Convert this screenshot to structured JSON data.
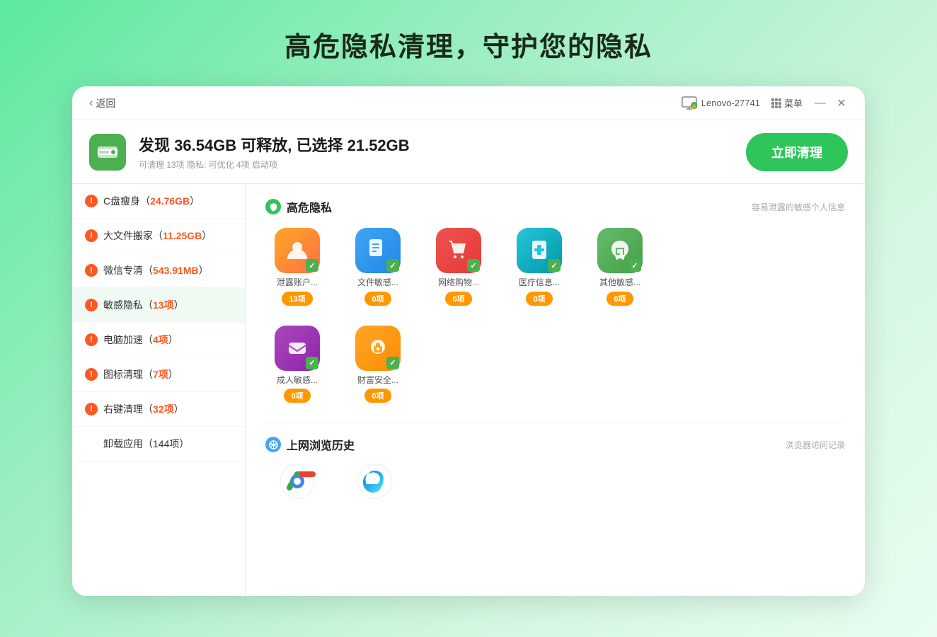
{
  "page": {
    "title": "高危隐私清理，守护您的隐私",
    "background": "linear-gradient(135deg, #5de8a0, #d4f7e0)"
  },
  "titlebar": {
    "back_label": "返回",
    "device_name": "Lenovo-27741",
    "menu_label": "菜单",
    "minimize_symbol": "—",
    "close_symbol": "✕"
  },
  "header": {
    "main_text": "发现 36.54GB 可释放, 已选择 21.52GB",
    "sub_text": "可清理 13项 隐私: 可优化 4项 启动项",
    "clean_button_label": "立即清理"
  },
  "sidebar": {
    "items": [
      {
        "id": "c-disk",
        "label": "C盘瘦身",
        "size": "24.76GB",
        "has_alert": true
      },
      {
        "id": "big-file",
        "label": "大文件搬家",
        "size": "11.25GB",
        "has_alert": true
      },
      {
        "id": "wechat",
        "label": "微信专清",
        "size": "543.91MB",
        "has_alert": true
      },
      {
        "id": "privacy",
        "label": "敏感隐私",
        "size": "13项",
        "has_alert": true,
        "active": true
      },
      {
        "id": "speed",
        "label": "电脑加速",
        "size": "4项",
        "has_alert": true
      },
      {
        "id": "icon-clean",
        "label": "图标清理",
        "size": "7项",
        "has_alert": true
      },
      {
        "id": "right-clean",
        "label": "右键清理",
        "size": "32项",
        "has_alert": true
      },
      {
        "id": "uninstall",
        "label": "卸载应用",
        "size": "144项",
        "has_alert": false
      }
    ]
  },
  "content": {
    "high_risk_section": {
      "title": "高危隐私",
      "desc": "容易泄露的敏感个人信息",
      "items": [
        {
          "id": "account-leak",
          "name": "泄露账户...",
          "count": "13项",
          "emoji": "👤",
          "bg": "#ffa726",
          "checked": true,
          "count_highlight": true
        },
        {
          "id": "file-sensitive",
          "name": "文件敏感...",
          "count": "0项",
          "emoji": "📄",
          "bg": "#42a5f5",
          "checked": true
        },
        {
          "id": "online-shop",
          "name": "网络购物...",
          "count": "0项",
          "emoji": "🛍",
          "bg": "#ef5350",
          "checked": true
        },
        {
          "id": "medical",
          "name": "医疗信息...",
          "count": "0项",
          "emoji": "🏥",
          "bg": "#26c6da",
          "checked": true
        },
        {
          "id": "other-sensitive",
          "name": "其他敏感...",
          "count": "0项",
          "emoji": "✋",
          "bg": "#66bb6a",
          "checked": true
        },
        {
          "id": "adult-sensitive",
          "name": "成人敏感...",
          "count": "0项",
          "emoji": "✉",
          "bg": "#ab47bc",
          "checked": true
        },
        {
          "id": "wealth-security",
          "name": "财富安全...",
          "count": "0项",
          "emoji": "💰",
          "bg": "#ffa726",
          "checked": true
        }
      ]
    },
    "browse_history_section": {
      "title": "上网浏览历史",
      "desc": "浏览器访问记录",
      "browsers": [
        {
          "id": "chrome",
          "name": "Chrome",
          "color": "#EA4335",
          "emoji": "⬤"
        },
        {
          "id": "edge",
          "name": "Edge",
          "color": "#0078D4",
          "emoji": "⬤"
        }
      ]
    }
  }
}
